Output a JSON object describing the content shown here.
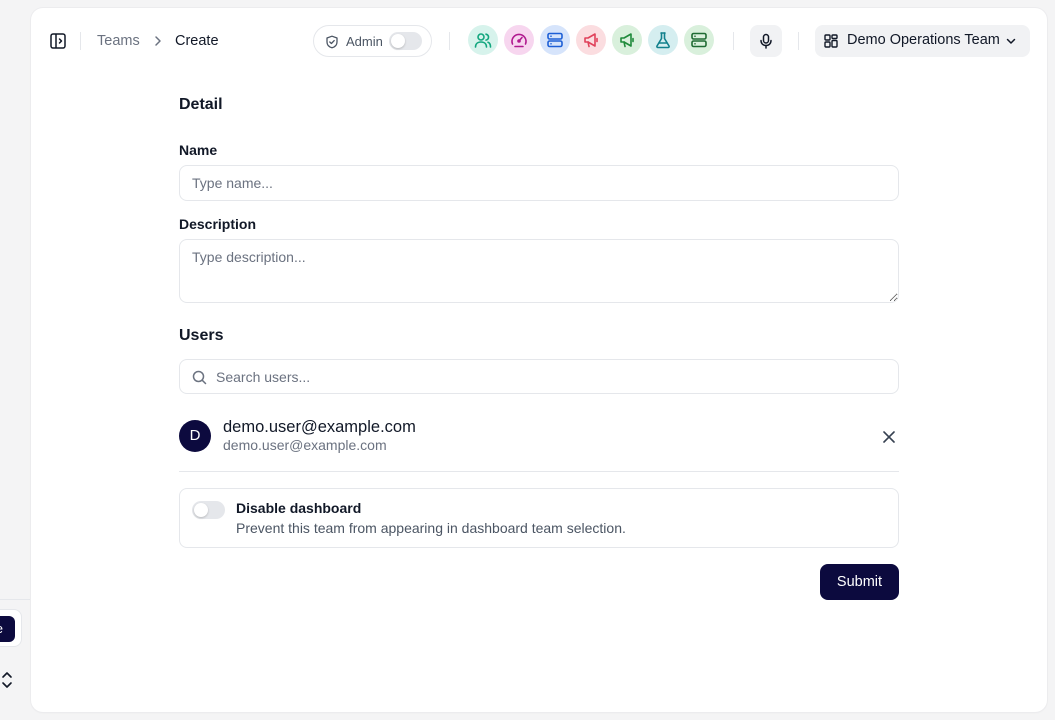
{
  "breadcrumb": {
    "parent": "Teams",
    "current": "Create"
  },
  "admin": {
    "label": "Admin",
    "enabled": false
  },
  "apps": [
    {
      "name": "users-app",
      "icon": "users-icon",
      "bg": "#d7f3ec",
      "fg": "#12a67e"
    },
    {
      "name": "gauge-app",
      "icon": "gauge-icon",
      "bg": "#f7d6ef",
      "fg": "#b0198f"
    },
    {
      "name": "server-app",
      "icon": "server-icon",
      "bg": "#d6e4fb",
      "fg": "#1d5fd6"
    },
    {
      "name": "megaphone-red-app",
      "icon": "megaphone-icon",
      "bg": "#fbdde0",
      "fg": "#e0415a"
    },
    {
      "name": "megaphone-green-app",
      "icon": "megaphone-icon",
      "bg": "#d9f0dc",
      "fg": "#1f8a3a"
    },
    {
      "name": "flask-app",
      "icon": "flask-icon",
      "bg": "#d5eef0",
      "fg": "#11808c"
    },
    {
      "name": "database-app",
      "icon": "server-icon",
      "bg": "#d9f0dc",
      "fg": "#1f6b33"
    }
  ],
  "team_selector": {
    "label": "Demo Operations Team",
    "icon": "grid-icon"
  },
  "form": {
    "detail_title": "Detail",
    "name_label": "Name",
    "name_placeholder": "Type name...",
    "name_value": "",
    "description_label": "Description",
    "description_placeholder": "Type description...",
    "users_title": "Users",
    "search_placeholder": "Search users...",
    "users": [
      {
        "initial": "D",
        "name": "demo.user@example.com",
        "email": "demo.user@example.com"
      }
    ],
    "disable_dashboard": {
      "title": "Disable dashboard",
      "description": "Prevent this team from appearing in dashboard team selection.",
      "enabled": false
    },
    "submit_label": "Submit"
  },
  "sidebar_remnant": {
    "button_text": "e"
  },
  "colors": {
    "primary": "#0c0a3e",
    "border": "#e5e7eb",
    "muted_text": "#6b7280"
  }
}
